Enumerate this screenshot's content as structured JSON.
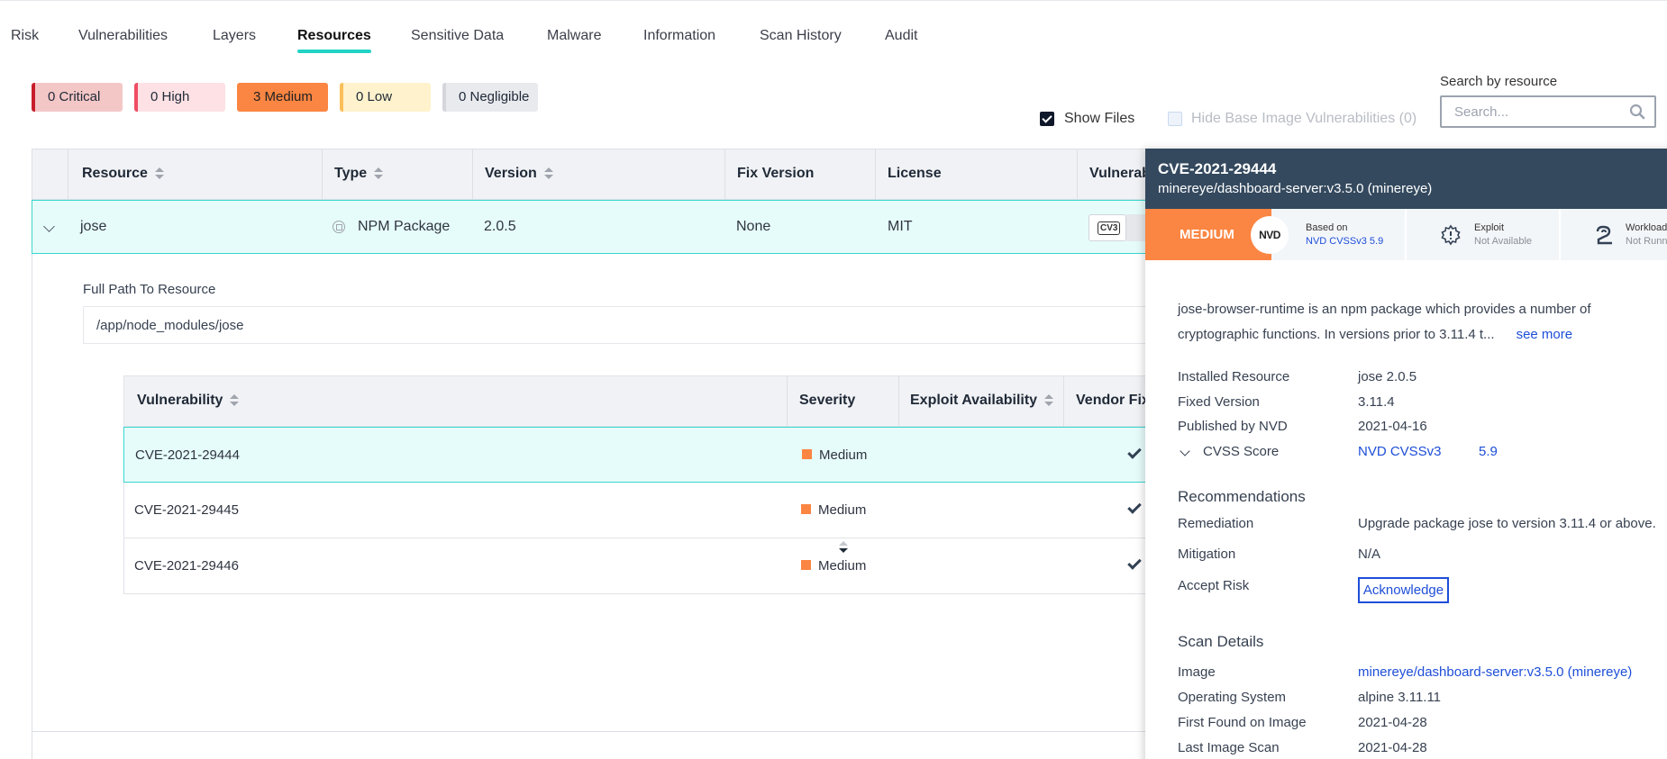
{
  "tabs": [
    "Risk",
    "Vulnerabilities",
    "Layers",
    "Resources",
    "Sensitive Data",
    "Malware",
    "Information",
    "Scan History",
    "Audit"
  ],
  "active_tab": "Resources",
  "severity_chips": {
    "critical": "0 Critical",
    "high": "0 High",
    "medium": "3 Medium",
    "low": "0 Low",
    "negligible": "0 Negligible"
  },
  "filters": {
    "show_files": "Show Files",
    "hide_base": "Hide Base Image Vulnerabilities (0)"
  },
  "search": {
    "label": "Search by resource",
    "placeholder": "Search..."
  },
  "table": {
    "headers": [
      "Resource",
      "Type",
      "Version",
      "Fix Version",
      "License",
      "Vulnerab"
    ],
    "row": {
      "resource": "jose",
      "type": "NPM Package",
      "version": "2.0.5",
      "fix_version": "None",
      "license": "MIT",
      "cvss_icon": "CV3"
    }
  },
  "expand": {
    "full_path_label": "Full Path To Resource",
    "full_path": "/app/node_modules/jose",
    "headers": [
      "Vulnerability",
      "Severity",
      "Exploit Availability",
      "Vendor Fix"
    ],
    "rows": [
      {
        "id": "CVE-2021-29444",
        "severity": "Medium",
        "exploit": "",
        "vendor_fix": "yes"
      },
      {
        "id": "CVE-2021-29445",
        "severity": "Medium",
        "exploit": "",
        "vendor_fix": "yes"
      },
      {
        "id": "CVE-2021-29446",
        "severity": "Medium",
        "exploit": "",
        "vendor_fix": "yes"
      }
    ]
  },
  "drawer": {
    "title": "CVE-2021-29444",
    "subtitle": "minereye/dashboard-server:v3.5.0 (minereye)",
    "severity": "MEDIUM",
    "nvd_label": "NVD",
    "based_on_label": "Based on",
    "based_on_value": "NVD CVSSv3 5.9",
    "exploit_label": "Exploit",
    "exploit_value": "Not Available",
    "workloads_label": "Workloads",
    "workloads_value": "Not Running",
    "description": "jose-browser-runtime is an npm package which provides a number of cryptographic functions. In versions prior to 3.11.4 t...",
    "see_more": "see more",
    "installed_resource_label": "Installed Resource",
    "installed_resource": "jose 2.0.5",
    "fixed_version_label": "Fixed Version",
    "fixed_version": "3.11.4",
    "published_label": "Published by NVD",
    "published": "2021-04-16",
    "cvss_label": "CVSS Score",
    "cvss_source": "NVD CVSSv3",
    "cvss_score": "5.9",
    "recommendations_title": "Recommendations",
    "remediation_label": "Remediation",
    "remediation": "Upgrade package jose to version 3.11.4 or above.",
    "mitigation_label": "Mitigation",
    "mitigation": "N/A",
    "accept_risk_label": "Accept Risk",
    "acknowledge": "Acknowledge",
    "scan_details_title": "Scan Details",
    "image_label": "Image",
    "image": "minereye/dashboard-server:v3.5.0 (minereye)",
    "os_label": "Operating System",
    "os": "alpine 3.11.11",
    "first_found_label": "First Found on Image",
    "first_found": "2021-04-28",
    "last_scan_label": "Last Image Scan",
    "last_scan": "2021-04-28"
  },
  "colors": {
    "accent": "#22d3c5",
    "medium": "#fb8542",
    "drawer_header": "#34495e",
    "link": "#1d4ed8"
  }
}
